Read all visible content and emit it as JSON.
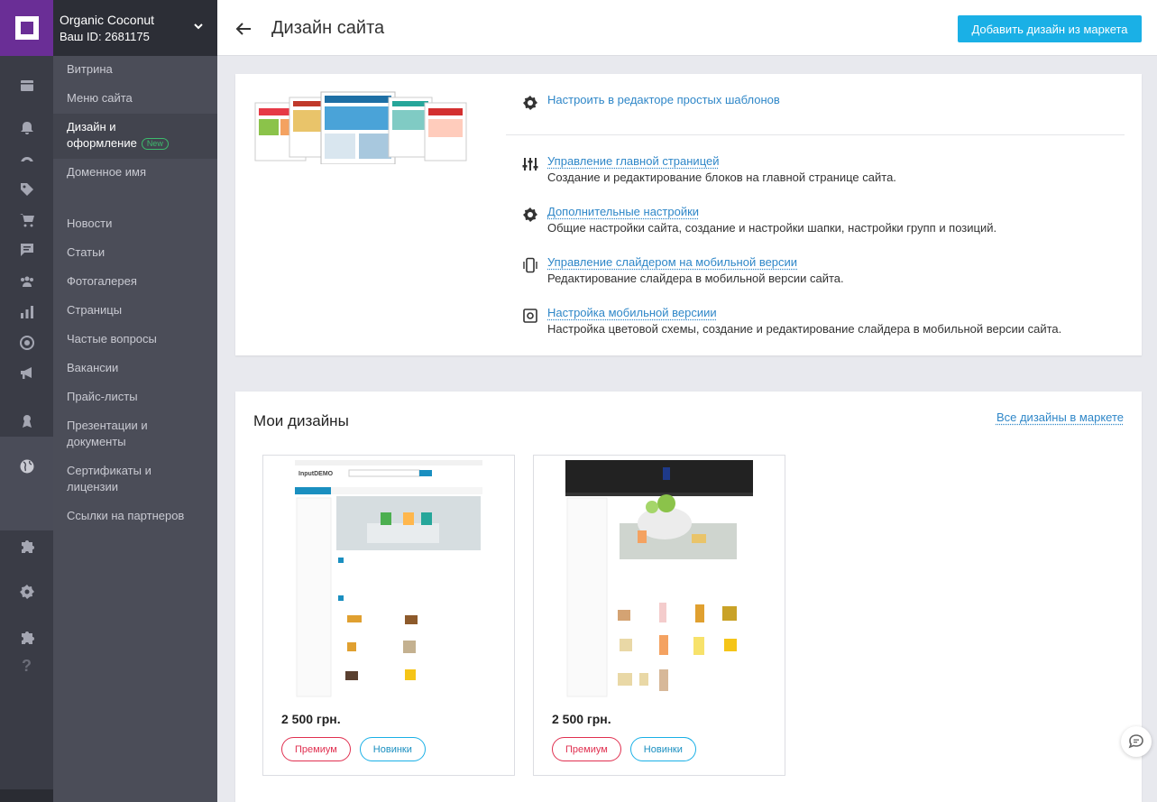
{
  "account": {
    "name": "Organic Coconut",
    "id_label": "Ваш ID: 2681175"
  },
  "menu": {
    "items": [
      {
        "label": "Витрина"
      },
      {
        "label": "Меню сайта"
      },
      {
        "label_line1": "Дизайн и",
        "label_line2": "оформление",
        "badge": "New"
      },
      {
        "label": "Доменное имя"
      },
      {
        "label": "Новости"
      },
      {
        "label": "Статьи"
      },
      {
        "label": "Фотогалерея"
      },
      {
        "label": "Страницы"
      },
      {
        "label": "Частые вопросы"
      },
      {
        "label": "Вакансии"
      },
      {
        "label": "Прайс-листы"
      },
      {
        "label_line1": "Презентации и",
        "label_line2": "документы"
      },
      {
        "label_line1": "Сертификаты и",
        "label_line2": "лицензии"
      },
      {
        "label": "Ссылки на партнеров"
      }
    ]
  },
  "header": {
    "title": "Дизайн сайта",
    "cta": "Добавить дизайн из маркета"
  },
  "options": {
    "simple_editor": "Настроить в редакторе простых шаблонов",
    "main_page": {
      "title": "Управление главной страницей",
      "desc": "Создание и редактирование блоков на главной странице сайта."
    },
    "extra": {
      "title": "Дополнительные настройки",
      "desc": "Общие настройки сайта, создание и настройки шапки, настройки групп и позиций."
    },
    "mobile_slider": {
      "title": "Управление слайдером на мобильной версии",
      "desc": "Редактирование слайдера в мобильной версии сайта."
    },
    "mobile": {
      "title": "Настройка мобильной версиии",
      "desc": "Настройка цветовой схемы, создание и редактирование слайдера в мобильной версии сайта."
    }
  },
  "my_designs": {
    "title": "Мои дизайны",
    "all_link": "Все дизайны в маркете",
    "items": [
      {
        "price": "2 500 грн.",
        "tag_premium": "Премиум",
        "tag_new": "Новинки",
        "preview_logo": "InputDEMO"
      },
      {
        "price": "2 500 грн.",
        "tag_premium": "Премиум",
        "tag_new": "Новинки"
      }
    ]
  },
  "colors": {
    "accent": "#1ab0e6",
    "brand": "#6a2e96",
    "link": "#2f87c8",
    "premium": "#e03050"
  }
}
